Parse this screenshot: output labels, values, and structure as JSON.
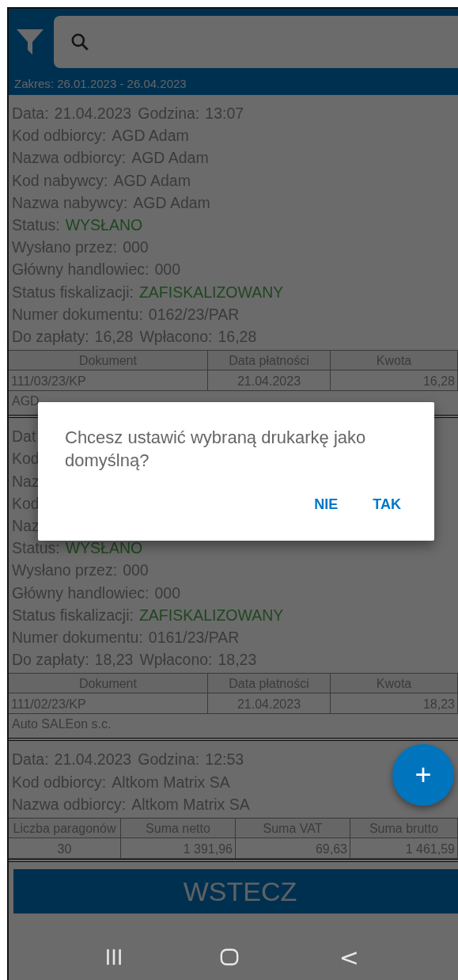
{
  "header": {
    "range": "Zakres: 26.01.2023 - 26.04.2023"
  },
  "cards": [
    {
      "lines": [
        [
          {
            "label": "Data:",
            "value": "21.04.2023",
            "kind": "plain"
          },
          {
            "label": "Godzina:",
            "value": "13:07",
            "kind": "plain"
          }
        ],
        [
          {
            "label": "Kod odbiorcy:",
            "value": "AGD Adam",
            "kind": "plain"
          }
        ],
        [
          {
            "label": "Nazwa odbiorcy:",
            "value": "AGD Adam",
            "kind": "plain"
          }
        ],
        [
          {
            "label": "Kod nabywcy:",
            "value": "AGD Adam",
            "kind": "plain"
          }
        ],
        [
          {
            "label": "Nazwa nabywcy:",
            "value": "AGD Adam",
            "kind": "plain"
          }
        ],
        [
          {
            "label": "Status:",
            "value": "WYSŁANO",
            "kind": "status"
          }
        ],
        [
          {
            "label": "Wysłano przez:",
            "value": "000",
            "kind": "plain"
          }
        ],
        [
          {
            "label": "Główny handlowiec:",
            "value": "000",
            "kind": "plain"
          }
        ],
        [
          {
            "label": "Status fiskalizacji:",
            "value": "ZAFISKALIZOWANY",
            "kind": "status"
          }
        ],
        [
          {
            "label": "Numer dokumentu:",
            "value": "0162/23/PAR",
            "kind": "plain"
          }
        ],
        [
          {
            "label": "Do zapłaty:",
            "value": "16,28",
            "kind": "plain"
          },
          {
            "label": "Wpłacono:",
            "value": "16,28",
            "kind": "plain"
          }
        ]
      ],
      "table": {
        "kind": "payments",
        "columns": [
          "Dokument",
          "Data płatności",
          "Kwota"
        ],
        "rows": [
          [
            "111/03/23/KP",
            "21.04.2023",
            "16,28"
          ]
        ]
      },
      "note": "AGD"
    },
    {
      "lines": [
        [
          {
            "label": "Dat"
          }
        ],
        [
          {
            "label": "Kod"
          }
        ],
        [
          {
            "label": "Naz"
          }
        ],
        [
          {
            "label": "Kod"
          }
        ],
        [
          {
            "label": "Naz"
          }
        ],
        [
          {
            "label": "Status:",
            "value": "WYSŁANO",
            "kind": "status"
          }
        ],
        [
          {
            "label": "Wysłano przez:",
            "value": "000",
            "kind": "plain"
          }
        ],
        [
          {
            "label": "Główny handlowiec:",
            "value": "000",
            "kind": "plain"
          }
        ],
        [
          {
            "label": "Status fiskalizacji:",
            "value": "ZAFISKALIZOWANY",
            "kind": "status"
          }
        ],
        [
          {
            "label": "Numer dokumentu:",
            "value": "0161/23/PAR",
            "kind": "plain"
          }
        ],
        [
          {
            "label": "Do zapłaty:",
            "value": "18,23",
            "kind": "plain"
          },
          {
            "label": "Wpłacono:",
            "value": "18,23",
            "kind": "plain"
          }
        ]
      ],
      "table": {
        "kind": "payments",
        "columns": [
          "Dokument",
          "Data płatności",
          "Kwota"
        ],
        "rows": [
          [
            "111/02/23/KP",
            "21.04.2023",
            "18,23"
          ]
        ]
      },
      "note": "Auto SALEon s.c."
    },
    {
      "lines": [
        [
          {
            "label": "Data:",
            "value": "21.04.2023",
            "kind": "plain"
          },
          {
            "label": "Godzina:",
            "value": "12:53",
            "kind": "plain"
          }
        ],
        [
          {
            "label": "Kod odbiorcy:",
            "value": "Altkom Matrix SA",
            "kind": "plain"
          }
        ],
        [
          {
            "label": "Nazwa odbiorcy:",
            "value": "Altkom Matrix SA",
            "kind": "plain"
          }
        ]
      ],
      "table": {
        "kind": "summary",
        "columns": [
          "Liczba paragonów",
          "Suma netto",
          "Suma VAT",
          "Suma brutto"
        ],
        "rows": [
          [
            "30",
            "1 391,96",
            "69,63",
            "1 461,59"
          ]
        ]
      }
    }
  ],
  "fab": {
    "label": "+"
  },
  "back_button": {
    "label": "WSTECZ"
  },
  "dialog": {
    "message": "Chcesz ustawić wybraną drukarkę jako domyślną?",
    "buttons": [
      "NIE",
      "TAK"
    ]
  },
  "nav_bar": {
    "back": "<"
  }
}
